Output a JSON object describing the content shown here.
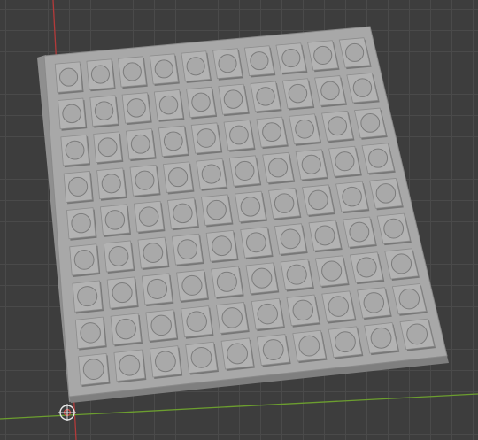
{
  "scene": {
    "object": "perforated-tray",
    "rows": 9,
    "cols": 10,
    "colors": {
      "background": "#3d3d3d",
      "grid": "#4a4a4a",
      "plate": "#a8a8a8",
      "plate_edge": "#7f7f7f",
      "cell": "#b3b3b3",
      "cell_shadow": "#777777",
      "x_axis": "#b33a3a",
      "y_axis": "#6c9e2f",
      "origin_gizmo": "#e6e6e6"
    }
  }
}
